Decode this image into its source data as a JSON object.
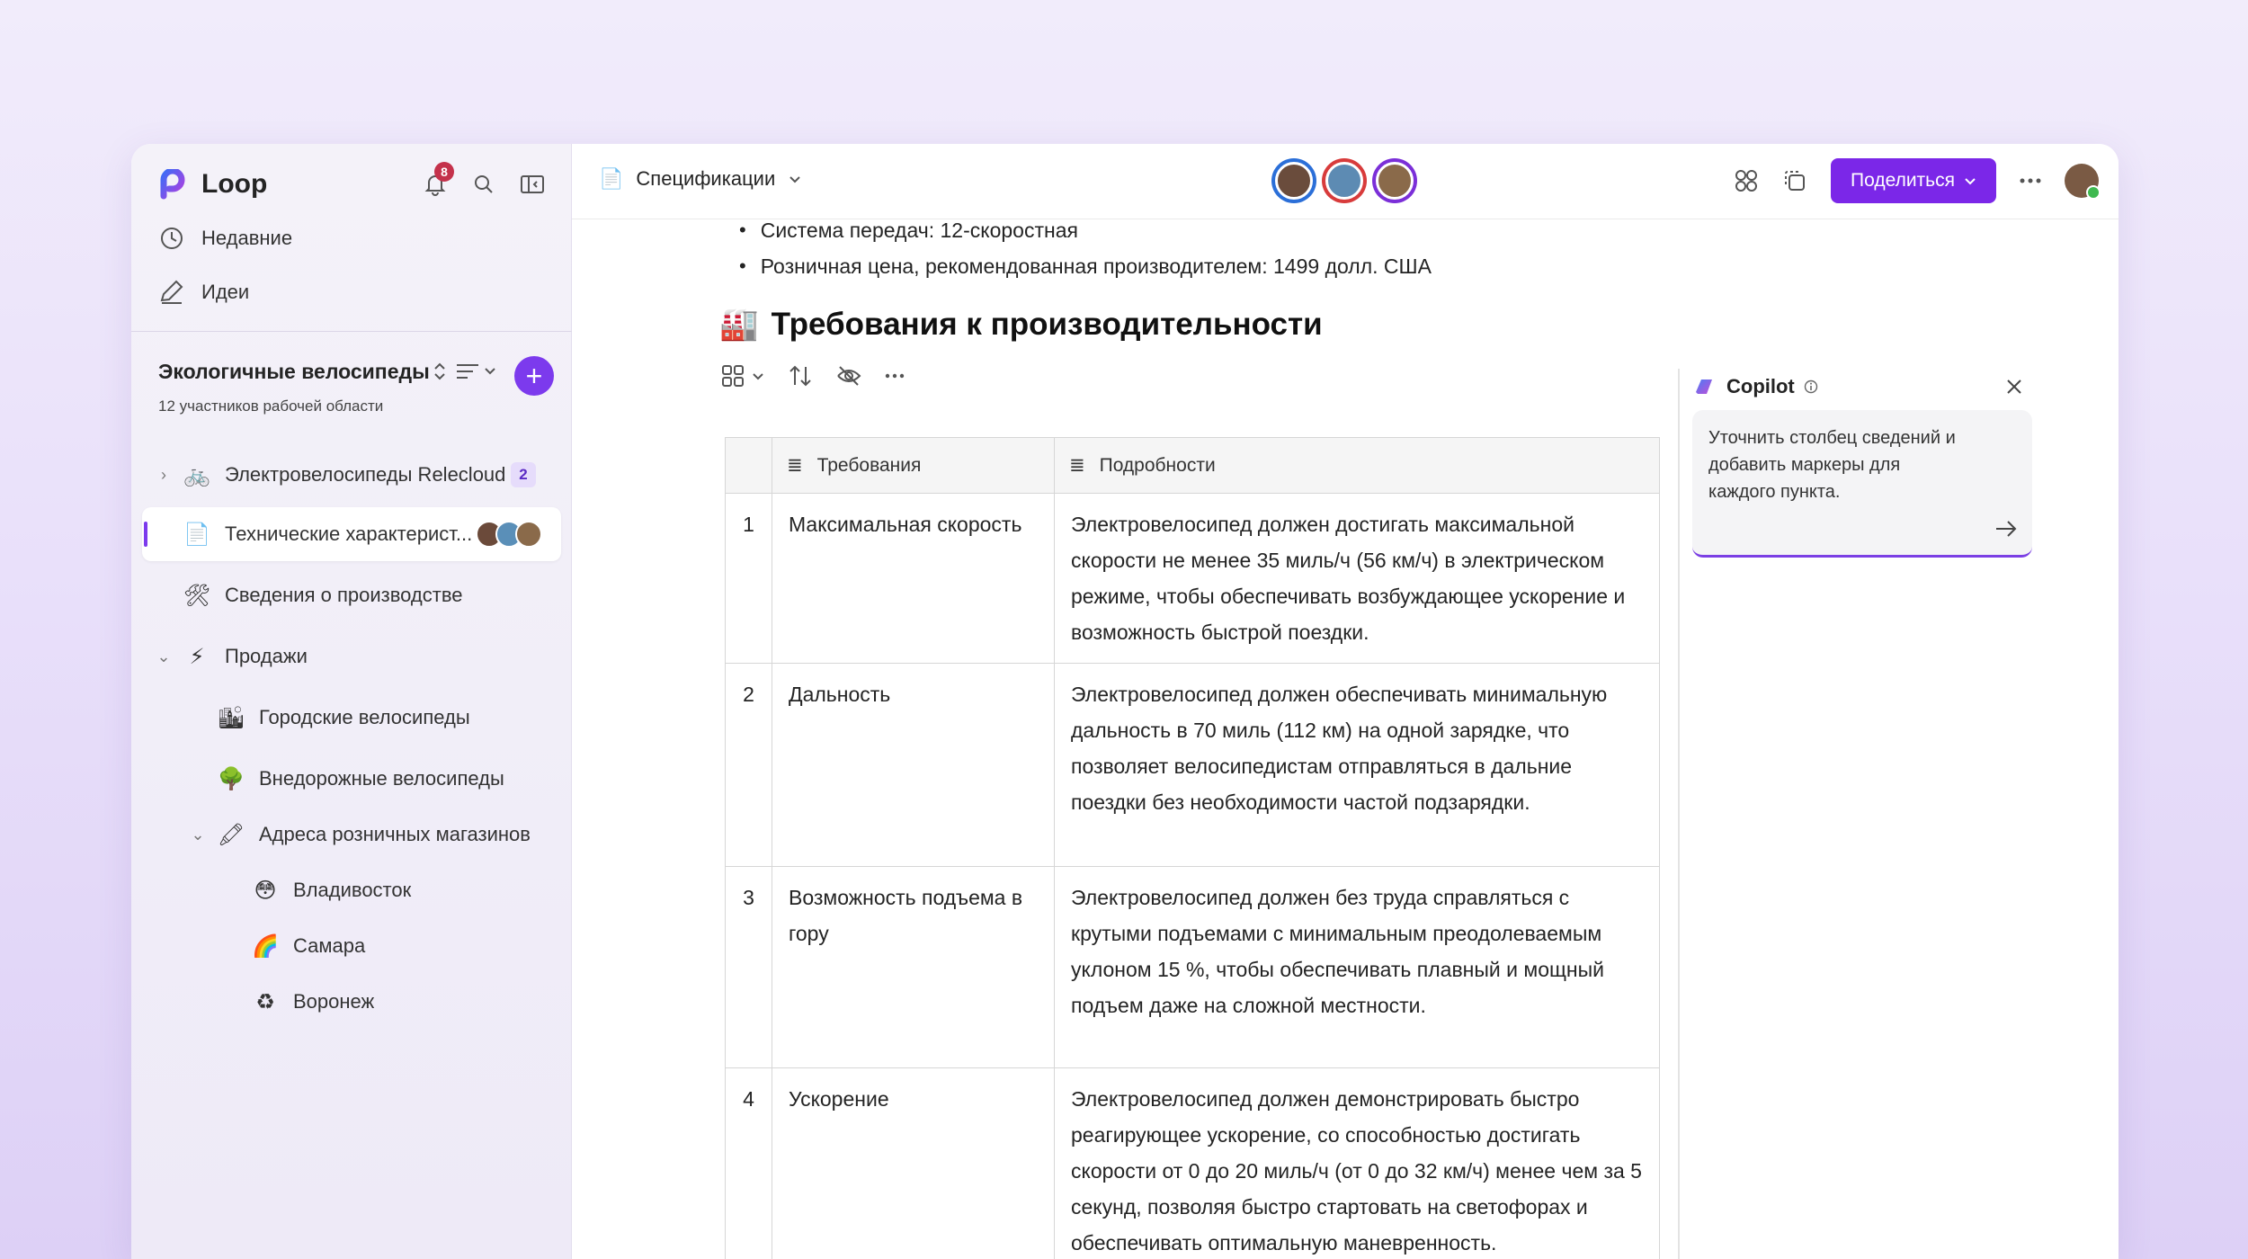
{
  "sidebar": {
    "app_name": "Loop",
    "notification_count": "8",
    "nav": [
      {
        "label": "Недавние",
        "icon": "clock-icon"
      },
      {
        "label": "Идеи",
        "icon": "pen-icon"
      }
    ],
    "workspace": {
      "title": "Экологичные велосипеды",
      "subtitle": "12 участников рабочей области"
    },
    "tree": [
      {
        "label": "Электровелосипеды Relecloud",
        "icon": "bicycle-icon",
        "badge": "2"
      },
      {
        "label": "Технические характерист...",
        "icon": "document-icon"
      },
      {
        "label": "Сведения о производстве",
        "icon": "tools-icon"
      },
      {
        "label": "Продажи",
        "icon": "lightning-icon"
      },
      {
        "label": "Городские велосипеды",
        "icon": "city-icon"
      },
      {
        "label": "Внедорожные велосипеды",
        "icon": "tree-icon"
      },
      {
        "label": "Адреса розничных магазинов",
        "icon": "crayon-icon"
      },
      {
        "label": "Владивосток",
        "icon": "face-icon"
      },
      {
        "label": "Самара",
        "icon": "rainbow-icon"
      },
      {
        "label": "Воронеж",
        "icon": "recycle-icon"
      }
    ]
  },
  "topbar": {
    "page_title": "Спецификации",
    "share_label": "Поделиться"
  },
  "content": {
    "bullets": [
      "Система передач: 12-скоростная",
      "Розничная цена, рекомендованная производителем: 1499 долл. США"
    ],
    "heading": "Требования к производительности",
    "table": {
      "headers": [
        "Требования",
        "Подробности"
      ],
      "rows": [
        {
          "n": "1",
          "req": "Максимальная скорость",
          "details": "Электровелосипед должен достигать максимальной скорости не менее 35 миль/ч (56 км/ч) в электрическом режиме, чтобы обеспечивать возбуждающее ускорение и возможность быстрой поездки."
        },
        {
          "n": "2",
          "req": "Дальность",
          "details": "Электровелосипед должен обеспечивать минимальную дальность в 70 миль (112 км) на одной зарядке, что позволяет велосипедистам отправляться в дальние поездки без необходимости частой подзарядки."
        },
        {
          "n": "3",
          "req": "Возможность подъема в гору",
          "details": "Электровелосипед должен без труда справляться с крутыми подъемами с минимальным преодолеваемым уклоном 15 %, чтобы обеспечивать плавный и мощный подъем даже на сложной местности."
        },
        {
          "n": "4",
          "req": "Ускорение",
          "details": "Электровелосипед должен демонстрировать быстро реагирующее ускорение, со способностью достигать скорости от 0 до 20 миль/ч (от 0 до 32 км/ч) менее чем за 5 секунд, позволяя быстро стартовать на светофорах и обеспечивать оптимальную маневренность."
        }
      ]
    }
  },
  "copilot": {
    "title": "Copilot",
    "prompt": "Уточнить столбец сведений и добавить маркеры для каждого пункта."
  },
  "colors": {
    "accent": "#7b27e8",
    "badge_red": "#c4314b"
  }
}
